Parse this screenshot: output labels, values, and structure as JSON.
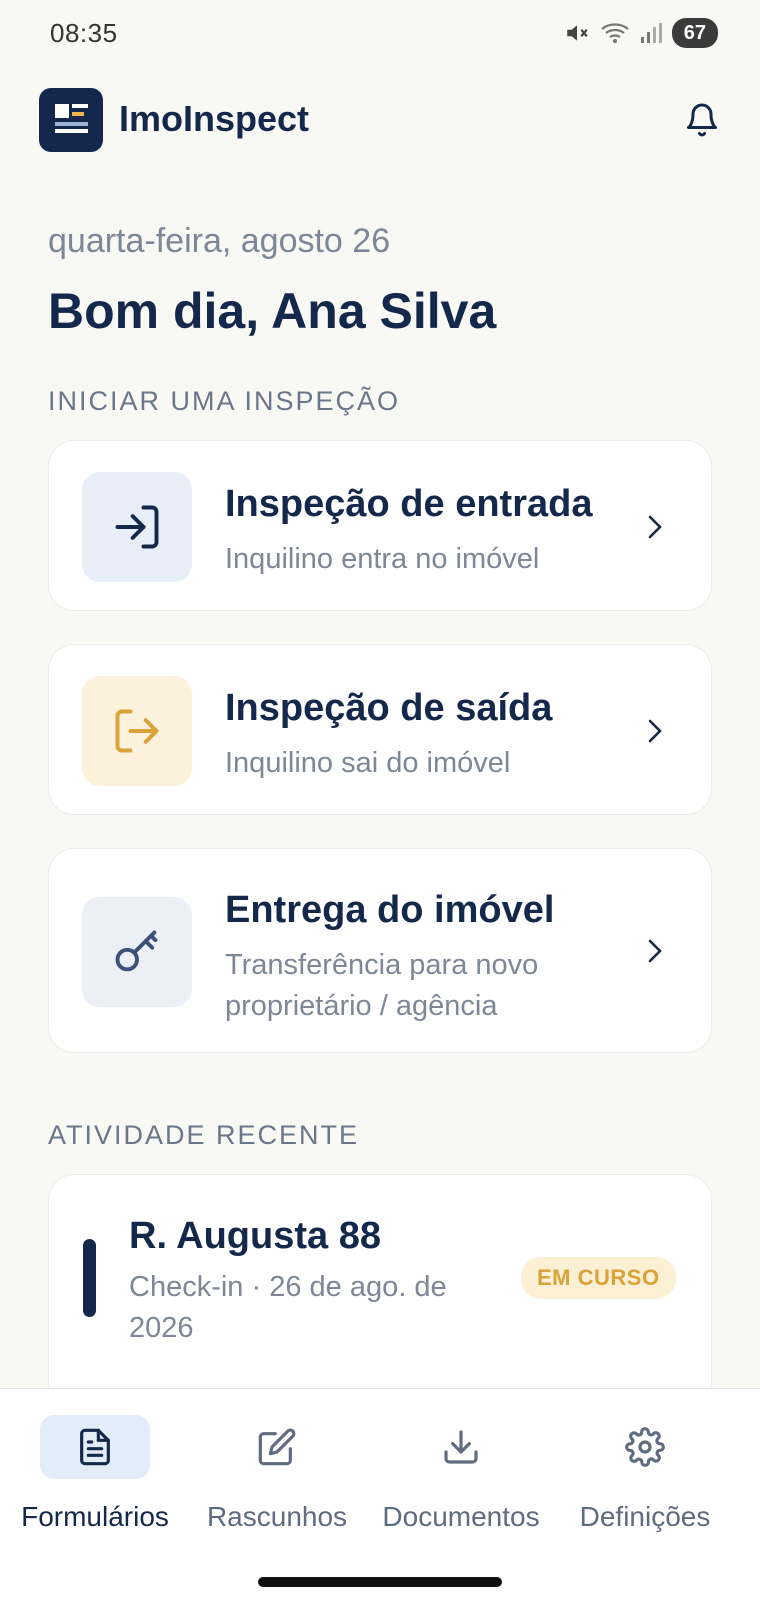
{
  "status_bar": {
    "time": "08:35",
    "battery": "67"
  },
  "header": {
    "brand": "ImoInspect"
  },
  "greeting": {
    "date": "quarta-feira, agosto 26",
    "title": "Bom dia, Ana Silva"
  },
  "start_section": {
    "label": "INICIAR UMA INSPEÇÃO",
    "cards": [
      {
        "title": "Inspeção de entrada",
        "subtitle": "Inquilino entra no imóvel",
        "icon": "sign-in-icon",
        "icon_bg": "#e8eef8"
      },
      {
        "title": "Inspeção de saída",
        "subtitle": "Inquilino sai do imóvel",
        "icon": "sign-out-icon",
        "icon_bg": "#fcf1da"
      },
      {
        "title": "Entrega do imóvel",
        "subtitle": "Transferência para novo proprietário / agência",
        "icon": "key-icon",
        "icon_bg": "#eceff5"
      }
    ]
  },
  "recent_section": {
    "label": "ATIVIDADE RECENTE",
    "items": [
      {
        "title": "R. Augusta 88",
        "subtitle": "Check-in · 26 de ago. de 2026",
        "status": "EM CURSO"
      }
    ]
  },
  "bottom_nav": {
    "items": [
      {
        "label": "Formulários",
        "icon": "document-icon",
        "active": true
      },
      {
        "label": "Rascunhos",
        "icon": "edit-icon",
        "active": false
      },
      {
        "label": "Documentos",
        "icon": "download-icon",
        "active": false
      },
      {
        "label": "Definições",
        "icon": "gear-icon",
        "active": false
      }
    ]
  },
  "colors": {
    "primary": "#14284b",
    "accent_orange": "#d9a33a",
    "background": "#f8f8f5"
  }
}
